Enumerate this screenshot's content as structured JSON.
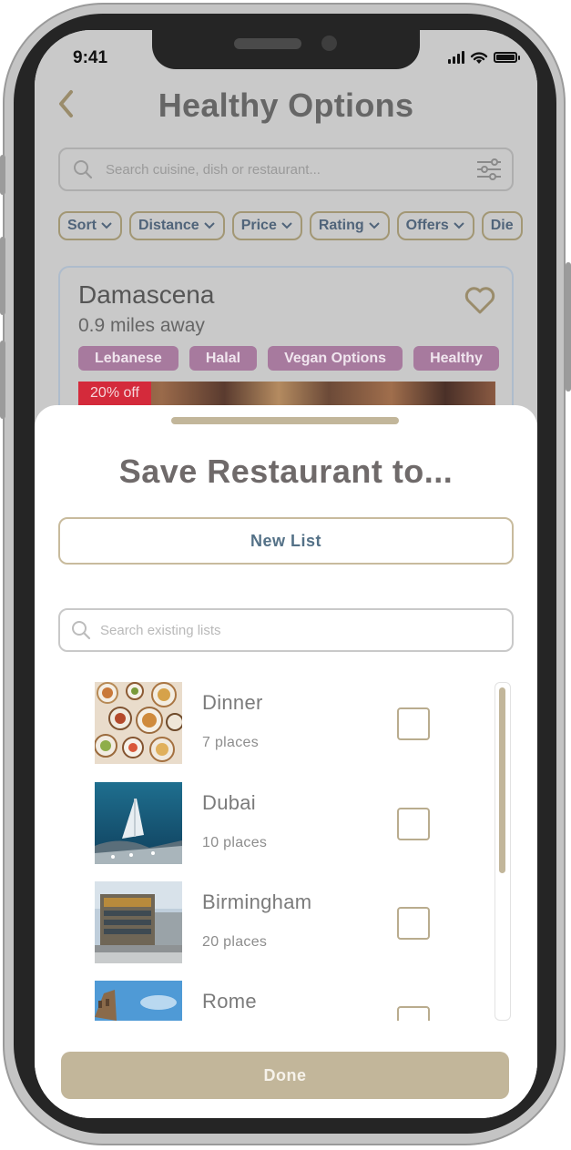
{
  "status_bar": {
    "time": "9:41"
  },
  "header": {
    "title": "Healthy Options"
  },
  "search": {
    "placeholder": "Search cuisine, dish or restaurant..."
  },
  "filter_chips": [
    "Sort",
    "Distance",
    "Price",
    "Rating",
    "Offers",
    "Die"
  ],
  "restaurant": {
    "name": "Damascena",
    "distance": "0.9 miles away",
    "tags": [
      "Lebanese",
      "Halal",
      "Vegan Options",
      "Healthy"
    ],
    "offer": "20% off"
  },
  "sheet": {
    "title": "Save Restaurant to...",
    "new_list_label": "New List",
    "search_placeholder": "Search existing lists",
    "lists": [
      {
        "name": "Dinner",
        "count": "7 places",
        "checked": false
      },
      {
        "name": "Dubai",
        "count": "10 places",
        "checked": false
      },
      {
        "name": "Birmingham",
        "count": "20 places",
        "checked": false
      },
      {
        "name": "Rome",
        "count": "",
        "checked": false
      }
    ],
    "done_label": "Done"
  },
  "colors": {
    "accent_gold": "#c2b69a",
    "tag_purple": "#a77a9e",
    "offer_red": "#d42a3b",
    "link_blue": "#547187"
  }
}
